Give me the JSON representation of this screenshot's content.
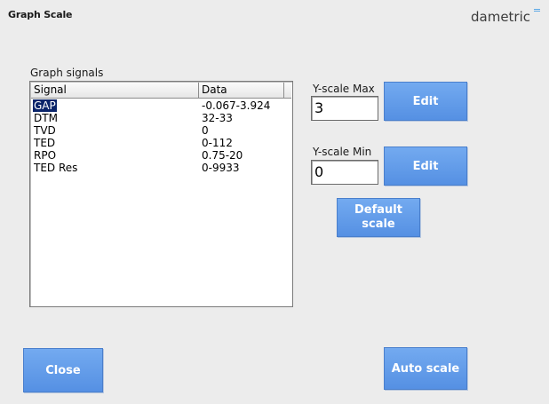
{
  "window": {
    "title": "Graph Scale",
    "brand": "dametric"
  },
  "signals": {
    "group_label": "Graph signals",
    "columns": [
      "Signal",
      "Data"
    ],
    "rows": [
      {
        "signal": "GAP",
        "data": "-0.067-3.924",
        "selected": true
      },
      {
        "signal": "DTM",
        "data": "32-33"
      },
      {
        "signal": "TVD",
        "data": "0"
      },
      {
        "signal": "TED",
        "data": "0-112"
      },
      {
        "signal": "RPO",
        "data": "0.75-20"
      },
      {
        "signal": "TED Res",
        "data": "0-9933"
      }
    ]
  },
  "yscale": {
    "max_label": "Y-scale Max",
    "max_value": "3",
    "min_label": "Y-scale Min",
    "min_value": "0",
    "edit_label": "Edit",
    "default_label_line1": "Default",
    "default_label_line2": "scale"
  },
  "footer": {
    "close_label": "Close",
    "auto_scale_label": "Auto scale"
  },
  "colors": {
    "button_blue": "#5f9ae8",
    "selection": "#0a246a",
    "brand_accent": "#5aa8e6"
  }
}
